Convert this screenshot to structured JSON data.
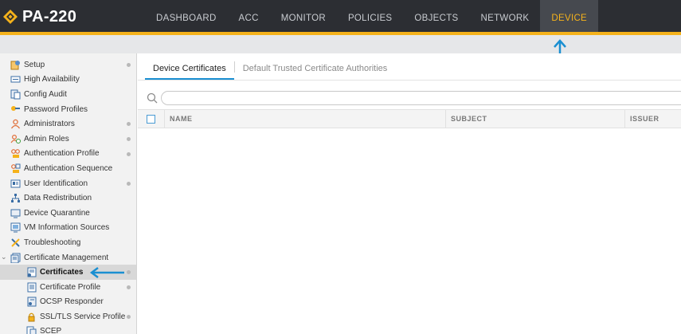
{
  "app": {
    "logo_text": "PA-220",
    "nav": [
      {
        "label": "DASHBOARD",
        "active": false
      },
      {
        "label": "ACC",
        "active": false
      },
      {
        "label": "MONITOR",
        "active": false
      },
      {
        "label": "POLICIES",
        "active": false
      },
      {
        "label": "OBJECTS",
        "active": false
      },
      {
        "label": "NETWORK",
        "active": false
      },
      {
        "label": "DEVICE",
        "active": true
      }
    ],
    "colors": {
      "accent": "#f5b21b",
      "topbar": "#2c2e33",
      "annotation_arrow": "#1a8fd1"
    }
  },
  "sidebar": {
    "items": [
      {
        "label": "Setup",
        "icon": "setup-icon",
        "dot": true
      },
      {
        "label": "High Availability",
        "icon": "high-availability-icon",
        "dot": false
      },
      {
        "label": "Config Audit",
        "icon": "config-audit-icon",
        "dot": false
      },
      {
        "label": "Password Profiles",
        "icon": "password-profiles-icon",
        "dot": false
      },
      {
        "label": "Administrators",
        "icon": "administrators-icon",
        "dot": true
      },
      {
        "label": "Admin Roles",
        "icon": "admin-roles-icon",
        "dot": true
      },
      {
        "label": "Authentication Profile",
        "icon": "authentication-profile-icon",
        "dot": true
      },
      {
        "label": "Authentication Sequence",
        "icon": "authentication-sequence-icon",
        "dot": false
      },
      {
        "label": "User Identification",
        "icon": "user-identification-icon",
        "dot": true
      },
      {
        "label": "Data Redistribution",
        "icon": "data-redistribution-icon",
        "dot": false
      },
      {
        "label": "Device Quarantine",
        "icon": "device-quarantine-icon",
        "dot": false
      },
      {
        "label": "VM Information Sources",
        "icon": "vm-information-sources-icon",
        "dot": false
      },
      {
        "label": "Troubleshooting",
        "icon": "troubleshooting-icon",
        "dot": false
      },
      {
        "label": "Certificate Management",
        "icon": "certificate-management-icon",
        "dot": false,
        "expanded": true
      }
    ],
    "subitems": [
      {
        "label": "Certificates",
        "icon": "certificates-icon",
        "dot": true,
        "selected": true
      },
      {
        "label": "Certificate Profile",
        "icon": "certificate-profile-icon",
        "dot": true
      },
      {
        "label": "OCSP Responder",
        "icon": "ocsp-responder-icon",
        "dot": false
      },
      {
        "label": "SSL/TLS Service Profile",
        "icon": "ssl-tls-service-profile-icon",
        "dot": true
      },
      {
        "label": "SCEP",
        "icon": "scep-icon",
        "dot": false
      }
    ]
  },
  "content": {
    "tabs": [
      {
        "label": "Device Certificates",
        "active": true
      },
      {
        "label": "Default Trusted Certificate Authorities",
        "active": false
      }
    ],
    "search": {
      "placeholder": "",
      "value": ""
    },
    "table": {
      "columns": [
        "NAME",
        "SUBJECT",
        "ISSUER"
      ],
      "rows": []
    }
  }
}
